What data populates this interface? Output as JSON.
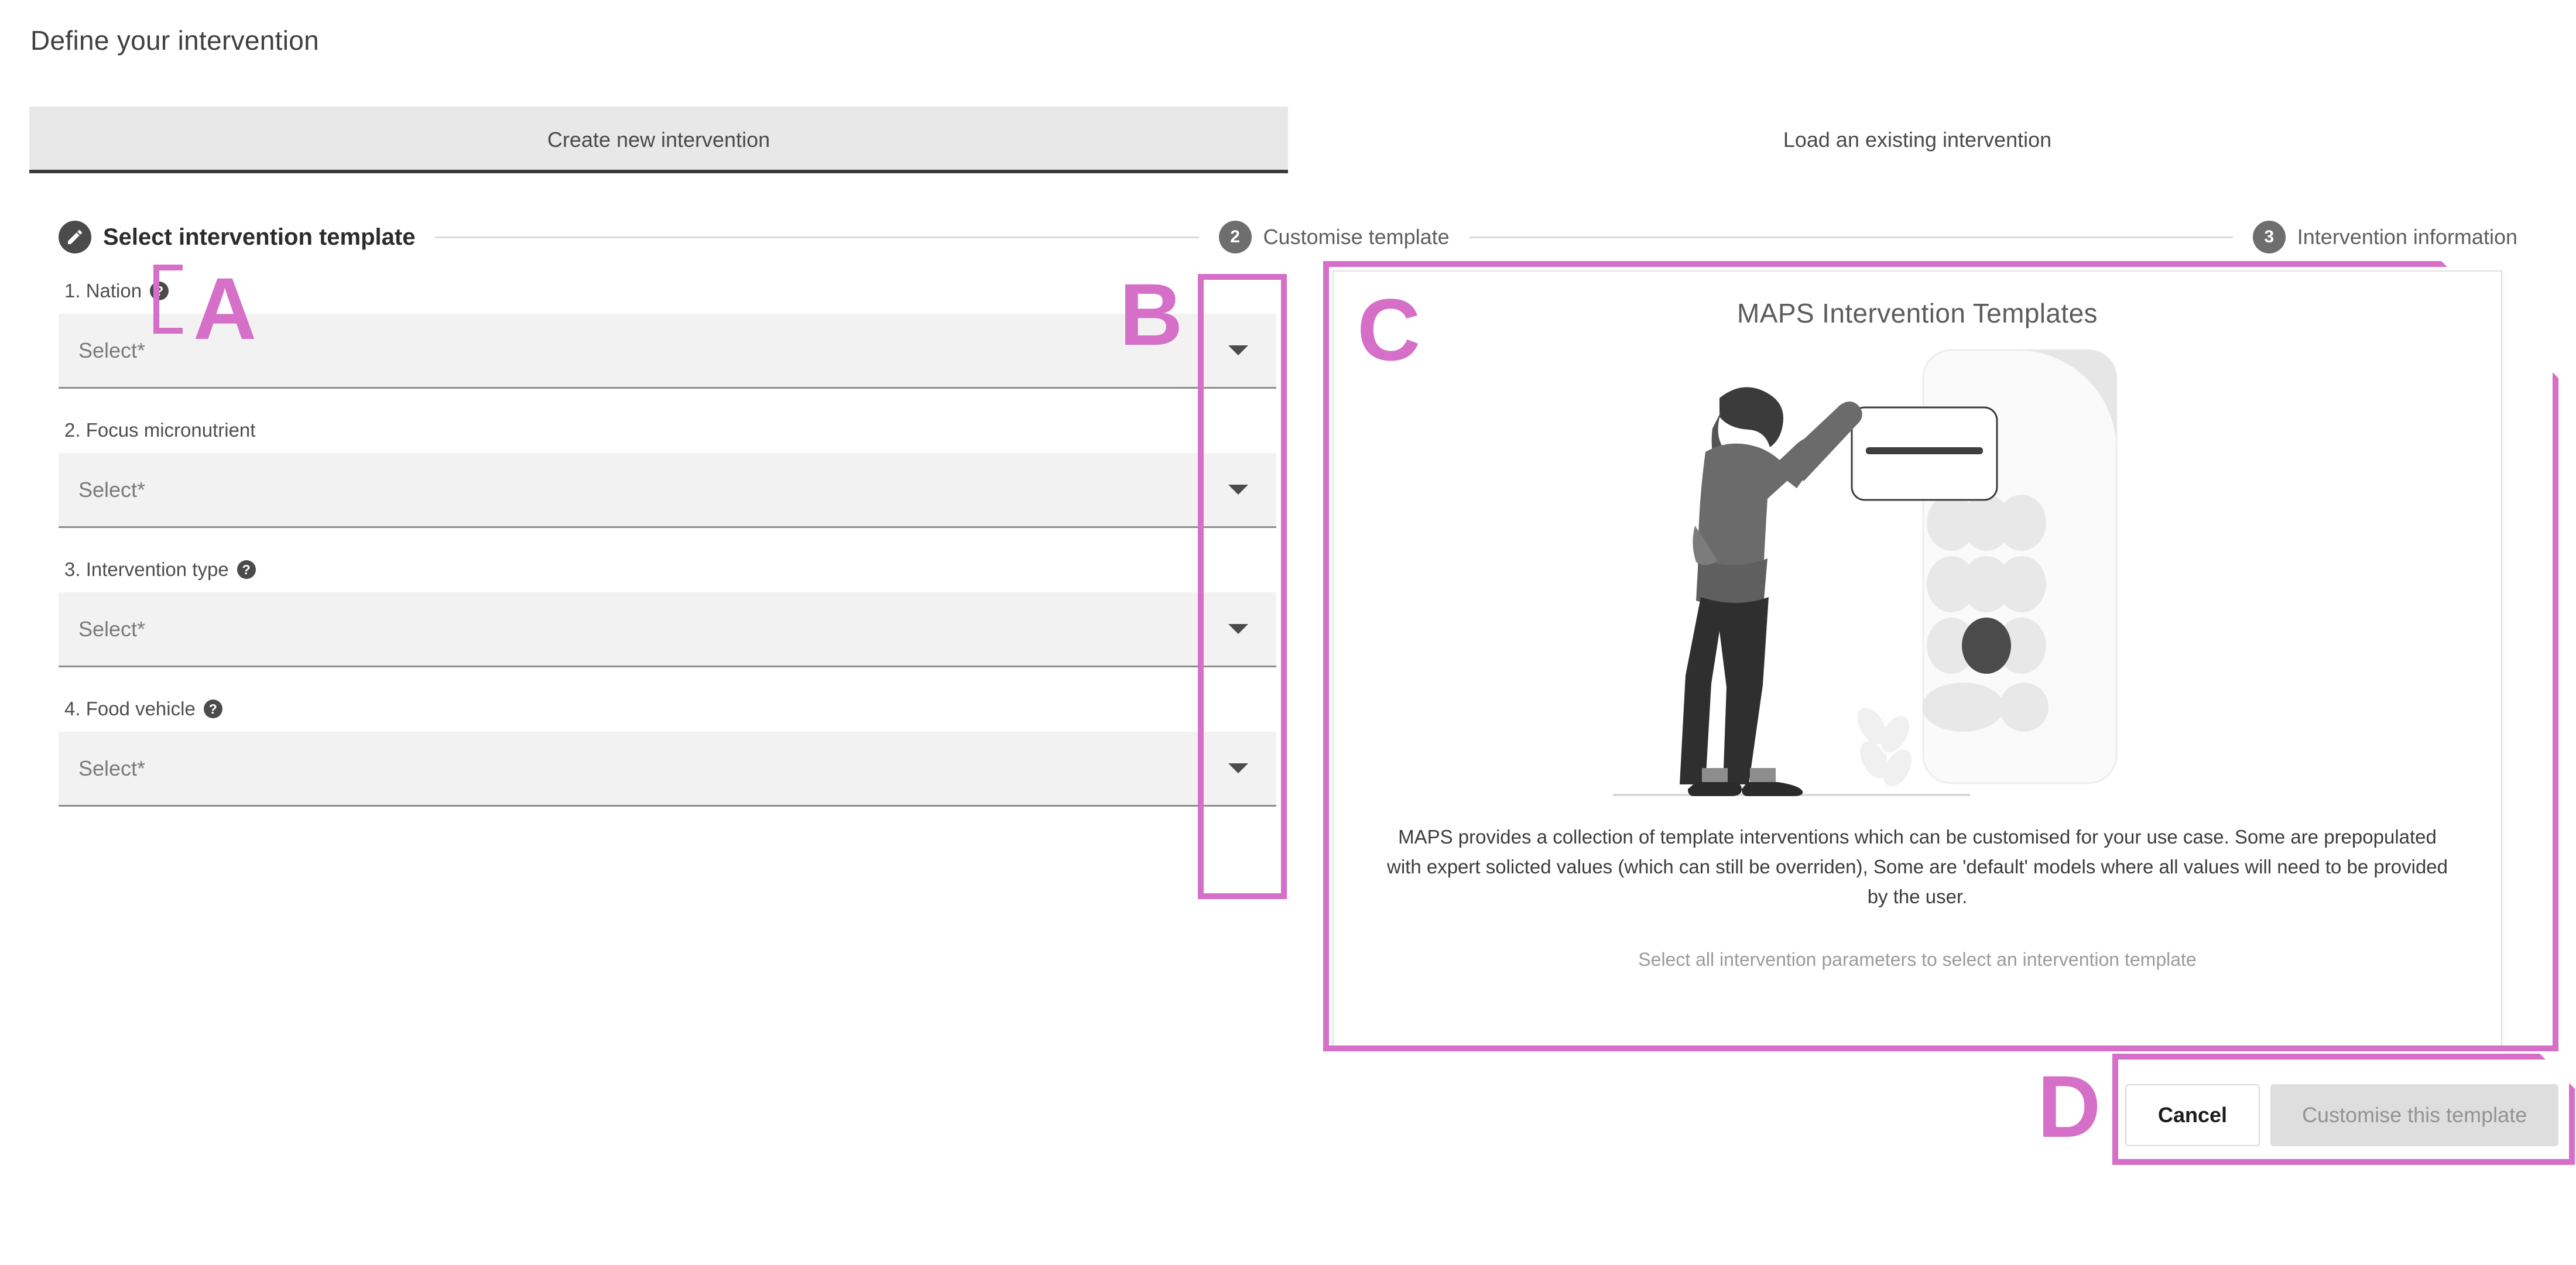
{
  "page": {
    "title": "Define your intervention"
  },
  "tabs": [
    {
      "label": "Create new intervention",
      "active": true
    },
    {
      "label": "Load an existing intervention",
      "active": false
    }
  ],
  "stepper": [
    {
      "badge": "edit-icon",
      "label": "Select intervention template",
      "state": "current"
    },
    {
      "badge": "2",
      "label": "Customise template",
      "state": "upcoming"
    },
    {
      "badge": "3",
      "label": "Intervention information",
      "state": "upcoming"
    }
  ],
  "form": {
    "fields": [
      {
        "label": "1. Nation",
        "help": true,
        "value": "Select*",
        "caret": "chevron-down-icon"
      },
      {
        "label": "2. Focus micronutrient",
        "help": false,
        "value": "Select*",
        "caret": "chevron-down-icon"
      },
      {
        "label": "3. Intervention type",
        "help": true,
        "value": "Select*",
        "caret": "chevron-down-icon"
      },
      {
        "label": "4. Food vehicle",
        "help": true,
        "value": "Select*",
        "caret": "chevron-down-icon"
      }
    ],
    "help_glyph": "?"
  },
  "card": {
    "title": "MAPS Intervention Templates",
    "description": "MAPS provides a collection of template interventions which can be customised for your use case. Some are prepopulated with expert solicted values (which can still be overriden), Some are 'default' models where all values will need to be provided by the user.",
    "hint": "Select all intervention parameters to select an intervention template",
    "illustration": "person-with-phone-keypad-illustration"
  },
  "actions": {
    "cancel_label": "Cancel",
    "primary_label": "Customise this template",
    "primary_disabled": true
  },
  "annotations": {
    "color": "#d56fc8",
    "items": [
      {
        "letter": "A",
        "target": "nation-help-icon"
      },
      {
        "letter": "B",
        "target": "dropdown-caret-column"
      },
      {
        "letter": "C",
        "target": "template-preview-card"
      },
      {
        "letter": "D",
        "target": "form-action-buttons"
      }
    ]
  }
}
